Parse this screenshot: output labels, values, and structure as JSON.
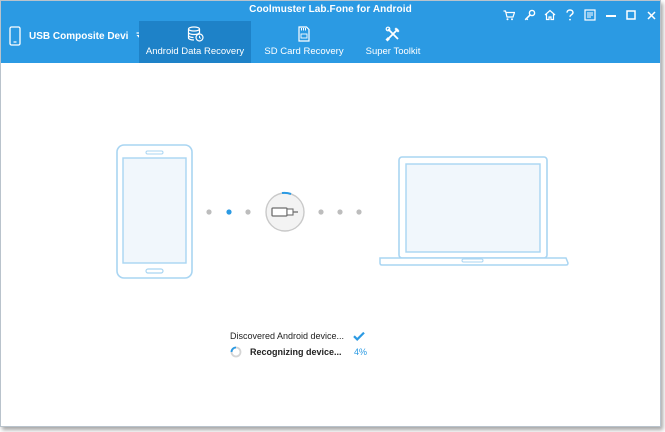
{
  "app": {
    "title": "Coolmuster Lab.Fone for Android"
  },
  "device_selector": {
    "label": "USB  Composite Devi"
  },
  "tabs": [
    {
      "label": "Android Data Recovery",
      "icon": "database-icon",
      "active": true
    },
    {
      "label": "SD Card Recovery",
      "icon": "sd-card-icon",
      "active": false
    },
    {
      "label": "Super Toolkit",
      "icon": "tools-icon",
      "active": false
    }
  ],
  "titlebar_icons": [
    "cart-icon",
    "key-icon",
    "home-icon",
    "help-icon",
    "feedback-icon",
    "minimize-icon",
    "maximize-icon",
    "close-icon"
  ],
  "status": {
    "discovered_text": "Discovered Android device...",
    "recognizing_text": "Recognizing device...",
    "percent_text": "4%"
  },
  "colors": {
    "header": "#2b9ae3",
    "active_tab": "#1e82c8",
    "accent": "#2b9ae3",
    "outline": "#b8ddf5"
  }
}
